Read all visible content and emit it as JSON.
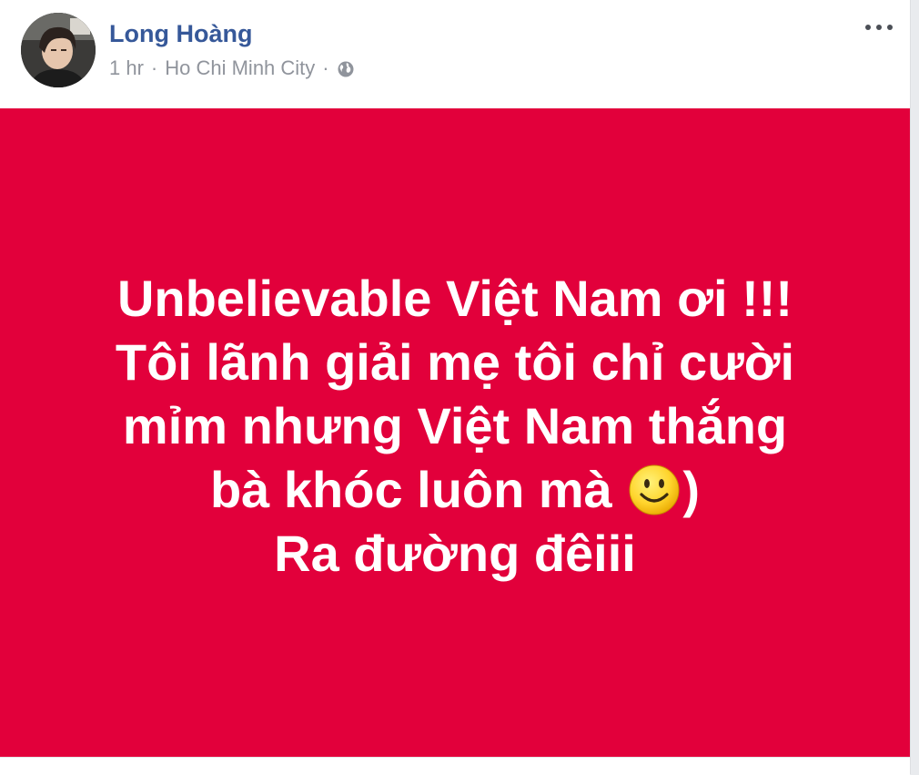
{
  "post": {
    "author": "Long Hoàng",
    "time": "1 hr",
    "separator": "·",
    "location": "Ho Chi Minh City",
    "privacy_icon": "globe-icon",
    "more_icon": "more-options-icon",
    "background_color": "#e2003b",
    "text": {
      "line1": "Unbelievable Việt Nam ơi !!!",
      "line2": "Tôi lãnh giải mẹ tôi chỉ cười",
      "line3": "mỉm nhưng Việt Nam thắng",
      "line4_before": "bà khóc luôn mà ",
      "line4_emoji": "smile-emoji-icon",
      "line4_after": ")",
      "line5": "Ra đường đêiii"
    }
  },
  "colors": {
    "author_link": "#365899",
    "meta_text": "#90949c",
    "post_text": "#ffffff"
  }
}
